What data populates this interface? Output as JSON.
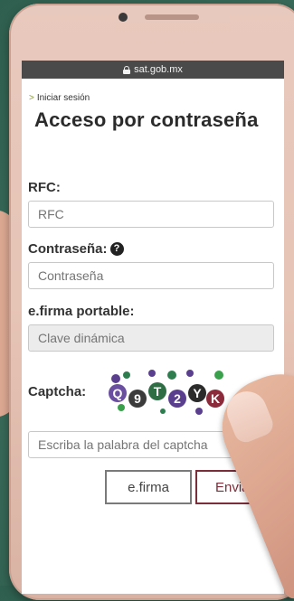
{
  "browser": {
    "url": "sat.gob.mx"
  },
  "breadcrumb": {
    "arrow": ">",
    "label": "Iniciar sesión"
  },
  "page": {
    "title": "Acceso por contraseña"
  },
  "form": {
    "rfc_label": "RFC:",
    "rfc_placeholder": "RFC",
    "password_label": "Contraseña:",
    "password_help": "?",
    "password_placeholder": "Contraseña",
    "efirma_label": "e.firma portable:",
    "efirma_placeholder": "Clave dinámica",
    "captcha_label": "Captcha:",
    "captcha_text": "Q9T2YK",
    "captcha_placeholder": "Escriba la palabra del captcha"
  },
  "buttons": {
    "efirma": "e.firma",
    "enviar": "Enviar"
  }
}
